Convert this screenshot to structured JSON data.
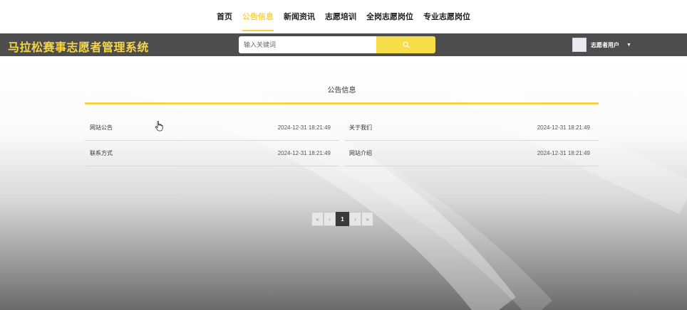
{
  "nav": {
    "items": [
      {
        "label": "首页",
        "active": false
      },
      {
        "label": "公告信息",
        "active": true
      },
      {
        "label": "新闻资讯",
        "active": false
      },
      {
        "label": "志愿培训",
        "active": false
      },
      {
        "label": "全岗志愿岗位",
        "active": false
      },
      {
        "label": "专业志愿岗位",
        "active": false
      }
    ]
  },
  "header": {
    "site_title": "马拉松赛事志愿者管理系统",
    "search_placeholder": "输入关键词",
    "user_name": "志愿者用户",
    "user_caret": "▼"
  },
  "section": {
    "title": "公告信息",
    "accent_color": "#f5d547"
  },
  "notices": [
    {
      "title": "网站公告",
      "date": "2024-12-31 18:21:49"
    },
    {
      "title": "关于我们",
      "date": "2024-12-31 18:21:49"
    },
    {
      "title": "联系方式",
      "date": "2024-12-31 18:21:49"
    },
    {
      "title": "网站介绍",
      "date": "2024-12-31 18:21:49"
    }
  ],
  "pagination": {
    "first": "«",
    "prev": "‹",
    "current": "1",
    "next": "›",
    "last": "»"
  },
  "icons": {
    "search": "search-icon",
    "avatar": "avatar-image",
    "cursor": "hand-pointer-icon"
  }
}
